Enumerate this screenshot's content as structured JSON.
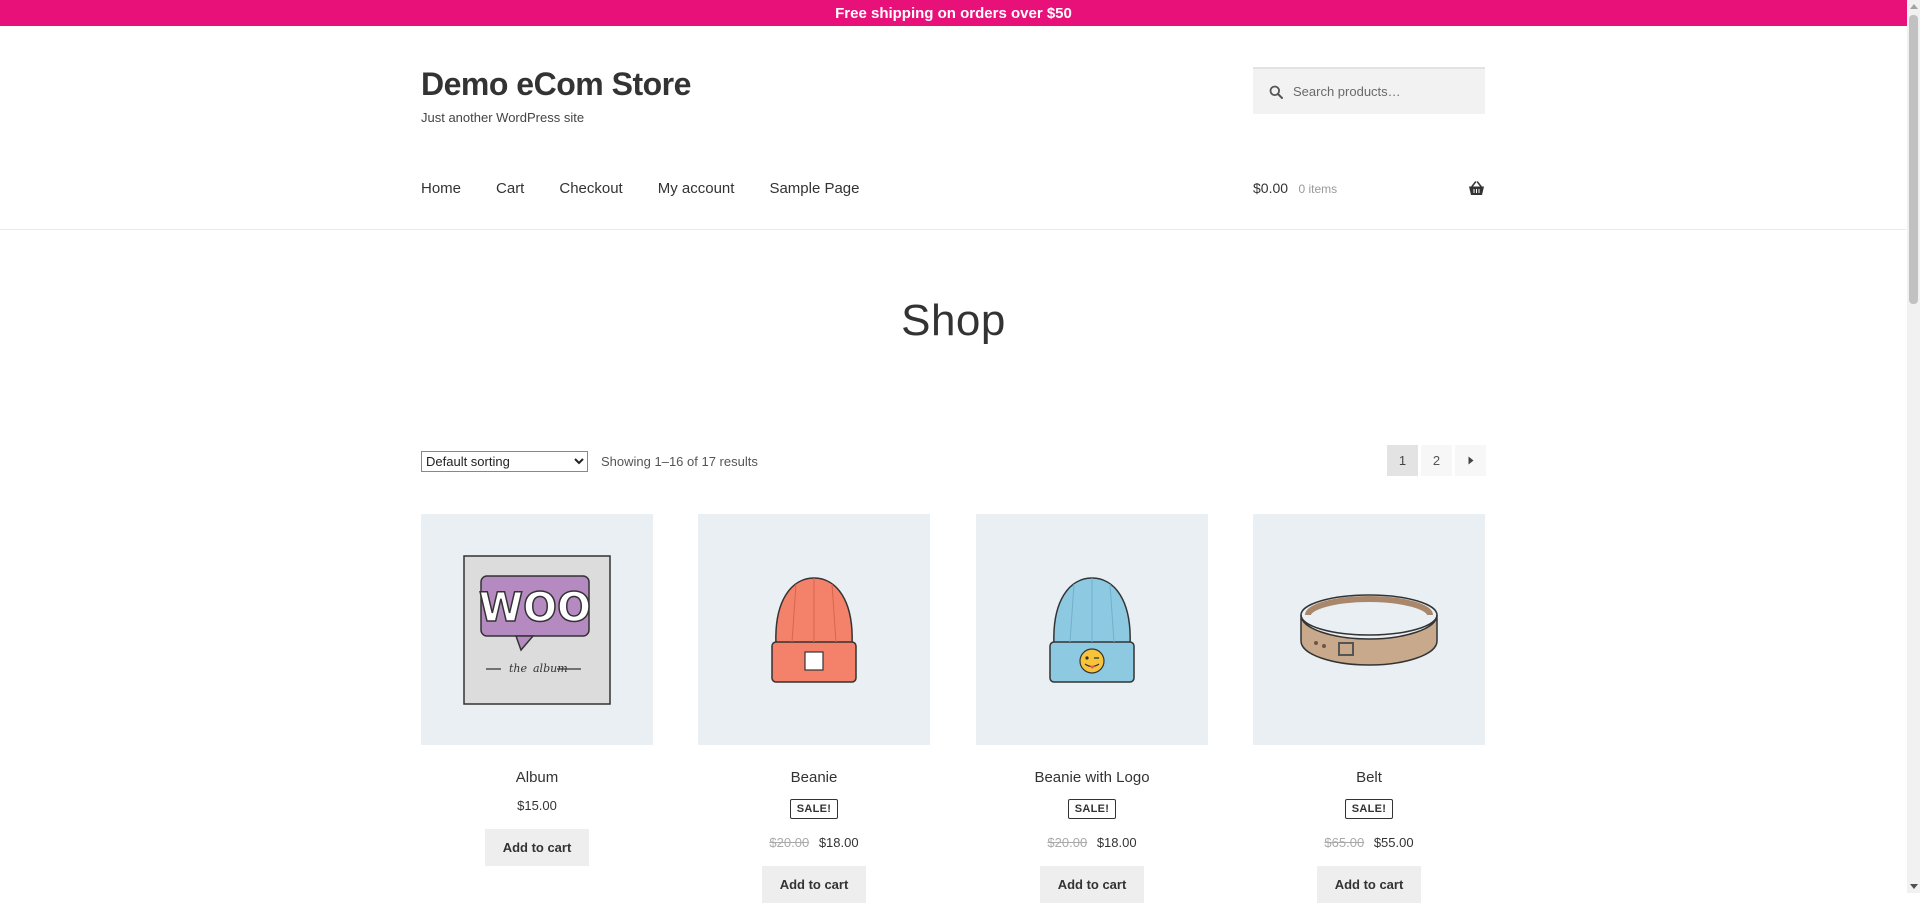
{
  "banner": {
    "text": "Free shipping on orders over $50"
  },
  "site": {
    "title": "Demo eCom Store",
    "tagline": "Just another WordPress site"
  },
  "search": {
    "placeholder": "Search products…"
  },
  "nav": {
    "items": [
      "Home",
      "Cart",
      "Checkout",
      "My account",
      "Sample Page"
    ]
  },
  "cart": {
    "amount": "$0.00",
    "count": "0 items"
  },
  "page": {
    "title": "Shop"
  },
  "toolbar": {
    "sort_selected": "Default sorting",
    "result_count": "Showing 1–16 of 17 results",
    "pages": [
      "1",
      "2"
    ],
    "current_page": "1"
  },
  "products": [
    {
      "name": "Album",
      "price": "$15.00",
      "button": "Add to cart"
    },
    {
      "name": "Beanie",
      "sale_badge": "SALE!",
      "old_price": "$20.00",
      "price": "$18.00",
      "button": "Add to cart"
    },
    {
      "name": "Beanie with Logo",
      "sale_badge": "SALE!",
      "old_price": "$20.00",
      "price": "$18.00",
      "button": "Add to cart"
    },
    {
      "name": "Belt",
      "sale_badge": "SALE!",
      "old_price": "$65.00",
      "price": "$55.00",
      "button": "Add to cart"
    }
  ],
  "colors": {
    "banner": "#e8117a",
    "thumb_bg": "#e9eff3"
  },
  "icons": [
    "search-icon",
    "basket-icon",
    "next-arrow-icon"
  ]
}
